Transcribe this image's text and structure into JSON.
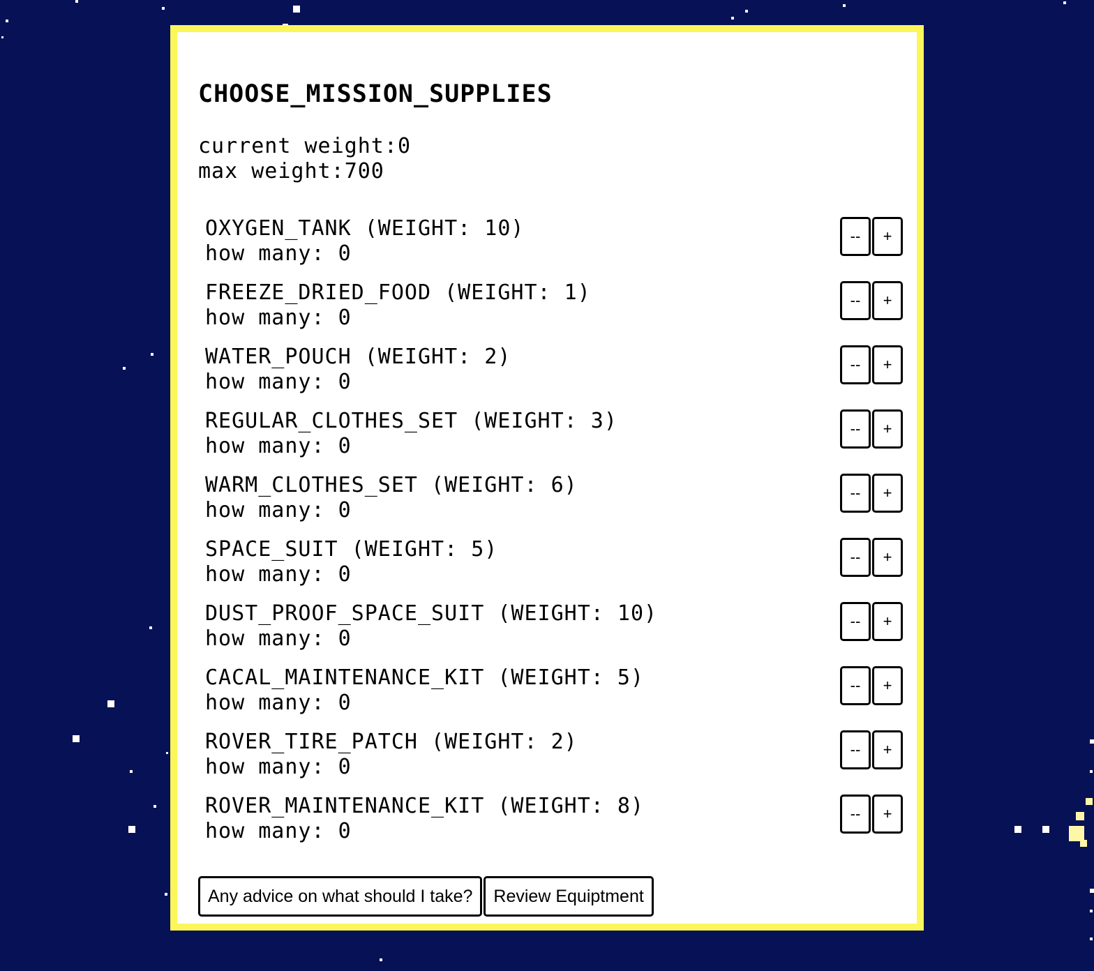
{
  "screen": {
    "title": "CHOOSE_MISSION_SUPPLIES",
    "current_weight_label": "current weight:",
    "current_weight": "0",
    "max_weight_label": "max weight:",
    "max_weight": "700"
  },
  "labels": {
    "how_many": "how many: ",
    "decrement": "--",
    "increment": "+"
  },
  "items": [
    {
      "name": "OXYGEN_TANK (WEIGHT: 10)",
      "count": "0"
    },
    {
      "name": "FREEZE_DRIED_FOOD (WEIGHT: 1)",
      "count": "0"
    },
    {
      "name": "WATER_POUCH (WEIGHT: 2)",
      "count": "0"
    },
    {
      "name": "REGULAR_CLOTHES_SET (WEIGHT: 3)",
      "count": "0"
    },
    {
      "name": "WARM_CLOTHES_SET (WEIGHT: 6)",
      "count": "0"
    },
    {
      "name": "SPACE_SUIT (WEIGHT: 5)",
      "count": "0"
    },
    {
      "name": "DUST_PROOF_SPACE_SUIT (WEIGHT: 10)",
      "count": "0"
    },
    {
      "name": "CACAL_MAINTENANCE_KIT (WEIGHT: 5)",
      "count": "0"
    },
    {
      "name": "ROVER_TIRE_PATCH (WEIGHT: 2)",
      "count": "0"
    },
    {
      "name": "ROVER_MAINTENANCE_KIT (WEIGHT: 8)",
      "count": "0"
    }
  ],
  "actions": {
    "advice": "Any advice on what should I take?",
    "review": "Review Equiptment"
  },
  "colors": {
    "background": "#071156",
    "panel_border": "#fbf65a",
    "panel": "#ffffff",
    "star": "#ffffff",
    "star_highlight": "#fff7a8"
  }
}
